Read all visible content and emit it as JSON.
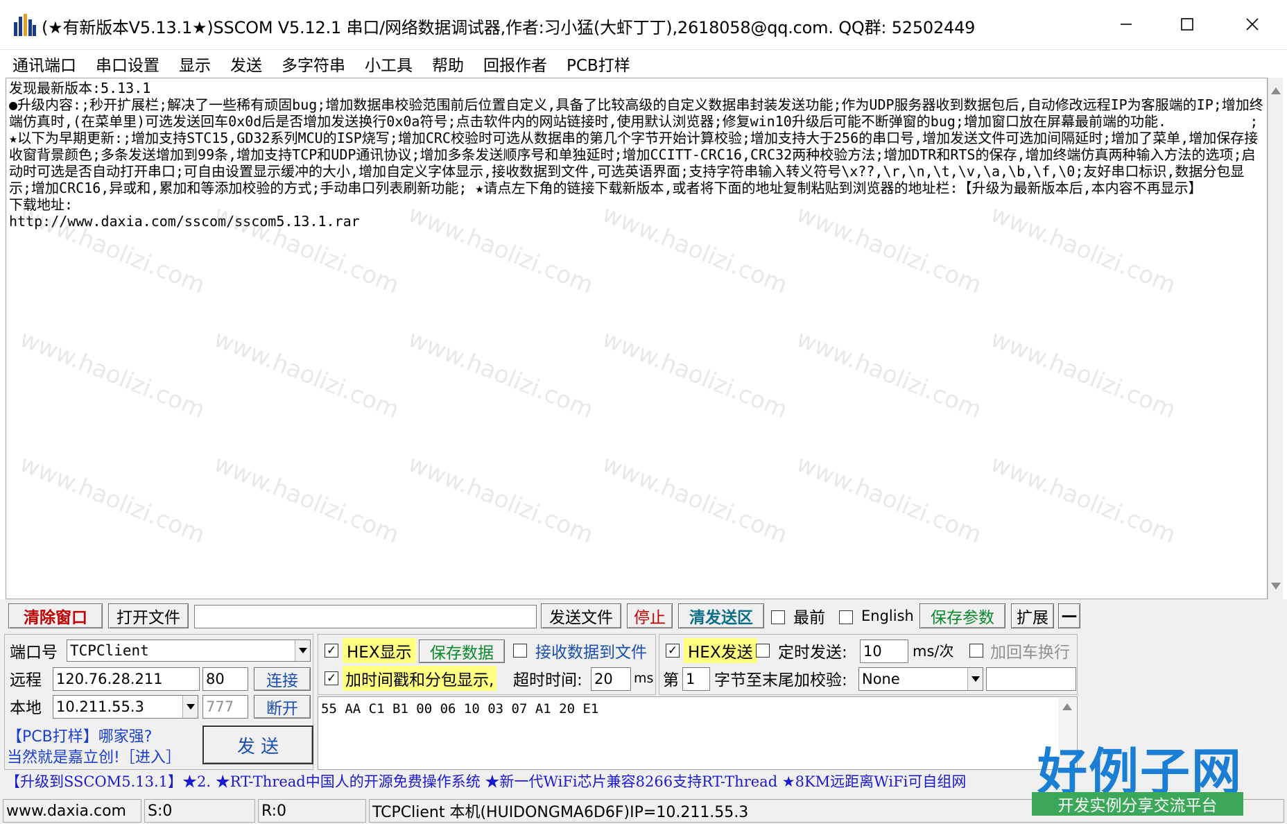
{
  "window": {
    "title": "(★有新版本V5.13.1★)SSCOM V5.12.1 串口/网络数据调试器,作者:习小猛(大虾丁丁),2618058@qq.com. QQ群: 52502449"
  },
  "menu": [
    "通讯端口",
    "串口设置",
    "显示",
    "发送",
    "多字符串",
    "小工具",
    "帮助",
    "回报作者",
    "PCB打样"
  ],
  "receive": {
    "text": "发现最新版本:5.13.1\n●升级内容:;秒开扩展栏;解决了一些稀有顽固bug;增加数据串校验范围前后位置自定义,具备了比较高级的自定义数据串封装发送功能;作为UDP服务器收到数据包后,自动修改远程IP为客服端的IP;增加终端仿真时,(在菜单里)可选发送回车0x0d后是否增加发送换行0x0a符号;点击软件内的网站链接时,使用默认浏览器;修复win10升级后可能不断弹窗的bug;增加窗口放在屏幕最前端的功能.          ;★以下为早期更新:;增加支持STC15,GD32系列MCU的ISP烧写;增加CRC校验时可选从数据串的第几个字节开始计算校验;增加支持大于256的串口号,增加发送文件可选加间隔延时;增加了菜单,增加保存接收窗背景颜色;多条发送增加到99条,增加支持TCP和UDP通讯协议;增加多条发送顺序号和单独延时;增加CCITT-CRC16,CRC32两种校验方法;增加DTR和RTS的保存,增加终端仿真两种输入方法的选项;启动时可选是否自动打开串口;可自由设置显示缓冲的大小,增加自定义字体显示,接收数据到文件,可选英语界面;支持字符串输入转义符号\\x??,\\r,\\n,\\t,\\v,\\a,\\b,\\f,\\0;友好串口标识,数据分包显示;增加CRC16,异或和,累加和等添加校验的方式;手动串口列表刷新功能; ★请点左下角的链接下载新版本,或者将下面的地址复制粘贴到浏览器的地址栏:【升级为最新版本后,本内容不再显示】\n下载地址:\nhttp://www.daxia.com/sscom/sscom5.13.1.rar"
  },
  "watermark": "www.haolizi.com",
  "toolbar": {
    "clear": "清除窗口",
    "open_file": "打开文件",
    "file_path": "",
    "send_file": "发送文件",
    "stop": "停止",
    "clear_send": "清发送区",
    "topmost": "最前",
    "english": "English",
    "save_params": "保存参数",
    "expand": "扩展",
    "collapse": "—"
  },
  "connection": {
    "port_label": "端口号",
    "port_value": "TCPClient",
    "remote_label": "远程",
    "remote_ip": "120.76.28.211",
    "remote_port": "80",
    "connect": "连接",
    "local_label": "本地",
    "local_ip": "10.211.55.3",
    "local_port": "777",
    "disconnect": "断开"
  },
  "receive_options": {
    "hex_display": "HEX显示",
    "hex_display_checked": true,
    "save_data": "保存数据",
    "recv_to_file": "接收数据到文件",
    "recv_to_file_checked": false,
    "timestamp": "加时间戳和分包显示,",
    "timestamp_checked": true,
    "timeout_label": "超时时间:",
    "timeout_value": "20",
    "timeout_unit": "ms"
  },
  "send_options": {
    "hex_send": "HEX发送",
    "hex_send_checked": true,
    "timed_send": "定时发送:",
    "timed_send_checked": false,
    "interval_value": "10",
    "interval_unit": "ms/次",
    "append_crlf": "加回车换行",
    "append_crlf_checked": false,
    "nth_label": "第",
    "nth_value": "1",
    "checksum_label": "字节至末尾加校验:",
    "checksum_value": "None",
    "checksum_extra": ""
  },
  "send_data": "55 AA C1 B1 00 06 10 03 07 A1 20 E1",
  "send_button": "发 送",
  "promo": {
    "line1": "【PCB打样】哪家强?",
    "line2": "当然就是嘉立创!［进入］"
  },
  "ticker": "【升级到SSCOM5.13.1】★2. ★RT-Thread中国人的开源免费操作系统 ★新一代WiFi芯片兼容8266支持RT-Thread ★8KM远距离WiFi可自组网",
  "statusbar": {
    "site": "www.daxia.com",
    "sent": "S:0",
    "received": "R:0",
    "info": "TCPClient 本机(HUIDONGMA6D6F)IP=10.211.55.3"
  },
  "logo": {
    "main": "好例子网",
    "sub": "开发实例分享交流平台"
  },
  "colors": {
    "clear_button": "#c00000",
    "hex_highlight": "#ffff80",
    "link": "#1a3fd0",
    "logo_blue": "#1a7fd4",
    "logo_green": "#3aa858"
  },
  "icons": {
    "app": "sscom-app-icon",
    "minimize": "minimize-icon",
    "maximize": "maximize-icon",
    "close": "close-icon"
  }
}
